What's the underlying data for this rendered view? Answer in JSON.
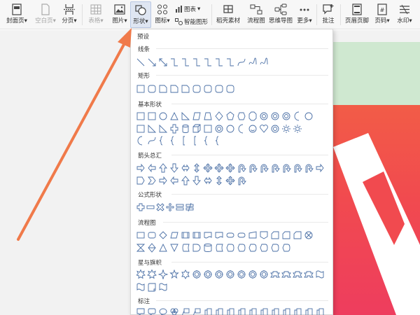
{
  "ribbon": {
    "cover_page": "封面页",
    "blank_page": "空白页",
    "page_break": "分页",
    "table": "表格",
    "picture": "图片",
    "shape": "形状",
    "icon": "图标",
    "chart": "图表",
    "smart_art": "智能图形",
    "shell_material": "稻壳素材",
    "flowchart": "流程图",
    "mind_map": "思维导图",
    "more": "更多",
    "comment": "批注",
    "header_footer": "页眉页脚",
    "page_number": "页码",
    "watermark": "水印"
  },
  "panel": {
    "preset": "预设",
    "sections": [
      {
        "key": "lines",
        "title": "线条"
      },
      {
        "key": "rect",
        "title": "矩形"
      },
      {
        "key": "basic",
        "title": "基本形状"
      },
      {
        "key": "arrows",
        "title": "箭头总汇"
      },
      {
        "key": "formula",
        "title": "公式形状"
      },
      {
        "key": "flow",
        "title": "流程图"
      },
      {
        "key": "stars",
        "title": "星与旗帜"
      },
      {
        "key": "callout",
        "title": "标注"
      }
    ]
  },
  "colors": {
    "arrow": "#f07a4a",
    "shape_stroke": "#4a6fa5",
    "slide_green": "#cfe8d0",
    "slide_red": "#f14a4f"
  }
}
